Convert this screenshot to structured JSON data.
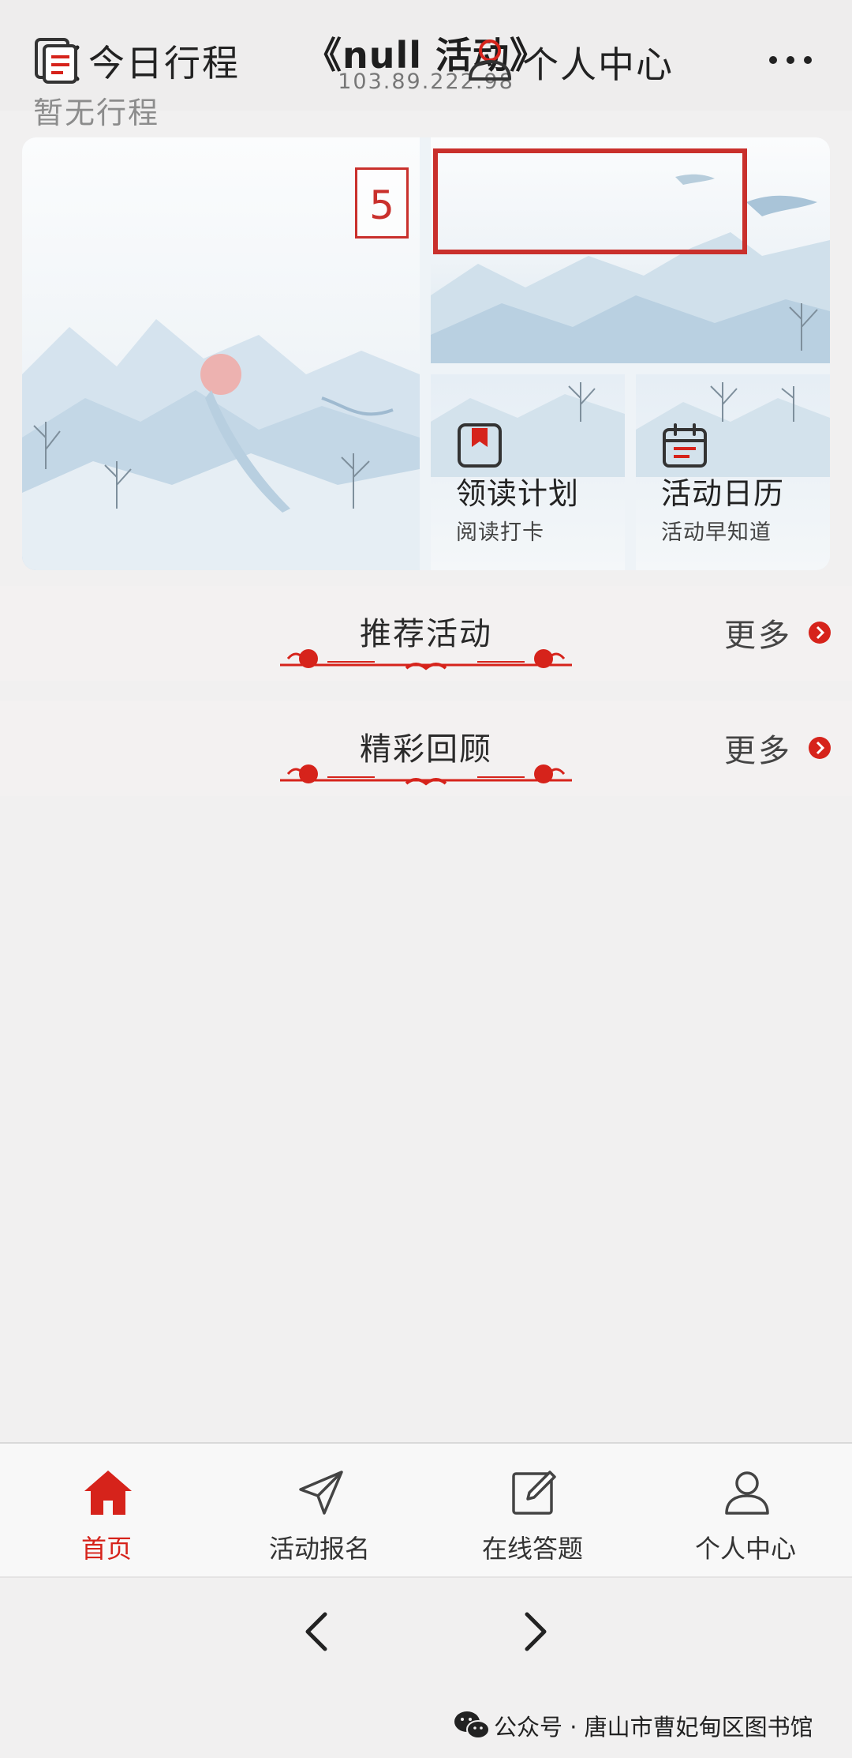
{
  "header": {
    "title": "《null 活动》",
    "url": "103.89.222.98"
  },
  "cards": {
    "today": {
      "title": "今日行程",
      "subtitle": "暂无行程"
    },
    "annotation_number": "5",
    "personal": {
      "title": "个人中心"
    },
    "reading": {
      "title": "领读计划",
      "subtitle": "阅读打卡"
    },
    "calendar": {
      "title": "活动日历",
      "subtitle": "活动早知道"
    }
  },
  "sections": [
    {
      "title": "推荐活动",
      "more": "更多"
    },
    {
      "title": "精彩回顾",
      "more": "更多"
    }
  ],
  "tabbar": {
    "items": [
      {
        "label": "首页",
        "icon": "home-icon",
        "active": true
      },
      {
        "label": "活动报名",
        "icon": "send-icon",
        "active": false
      },
      {
        "label": "在线答题",
        "icon": "edit-icon",
        "active": false
      },
      {
        "label": "个人中心",
        "icon": "user-icon",
        "active": false
      }
    ]
  },
  "watermark": {
    "text": "公众号 · 唐山市曹妃甸区图书馆"
  },
  "colors": {
    "accent": "#d6231b",
    "highlight_box": "#c9302c",
    "background": "#f1f0f0"
  }
}
